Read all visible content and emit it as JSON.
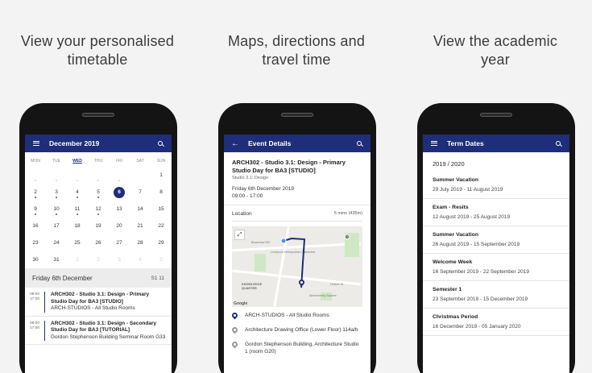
{
  "captions": [
    {
      "line1": "View your personalised",
      "line2": "timetable"
    },
    {
      "line1": "Maps, directions and",
      "line2": "travel time"
    },
    {
      "line1": "View the academic",
      "line2": "year"
    }
  ],
  "timetable": {
    "month_title": "December 2019",
    "weekdays": [
      "MON",
      "TUE",
      "WED",
      "THU",
      "FRI",
      "SAT",
      "SUN"
    ],
    "active_weekday": "WED",
    "rows": [
      [
        "",
        "",
        "",
        "",
        "",
        "",
        "1"
      ],
      [
        "2",
        "3",
        "4",
        "5",
        "6",
        "7",
        "8"
      ],
      [
        "9",
        "10",
        "11",
        "12",
        "13",
        "14",
        "15"
      ],
      [
        "16",
        "17",
        "18",
        "19",
        "20",
        "21",
        "22"
      ],
      [
        "23",
        "24",
        "25",
        "26",
        "27",
        "28",
        "29"
      ],
      [
        "30",
        "31",
        "1",
        "2",
        "3",
        "4",
        "5"
      ]
    ],
    "selected_day": "6",
    "day_header": "Friday 6th December",
    "week_label": "S1 11",
    "events": [
      {
        "start": "09:00",
        "end": "17:00",
        "title": "ARCH302 - Studio 3.1: Design - Primary Studio Day for BA3 [STUDIO]",
        "location": "ARCH-STUDIOS - All Studio Rooms"
      },
      {
        "start": "09:00",
        "end": "17:00",
        "title": "ARCH302 - Studio 3.1: Design - Secondary Studio Day for BA3 [TUTORIAL]",
        "location": "Gordon Stephenson Building Seminar Room G33"
      }
    ]
  },
  "event_details": {
    "title": "Event Details",
    "event_title": "ARCH302 - Studio 3.1: Design - Primary Studio Day for BA3 [STUDIO]",
    "event_subtitle": "Studio 3.1: Design",
    "date": "Friday 6th December 2019",
    "time": "09:00 - 17:00",
    "location_label": "Location",
    "travel_time": "5 mins (435m)",
    "map_labels": {
      "street": "Brownlow Hill",
      "cathedral": "Liverpool Metropolitan Cathedral",
      "quarter": "KNOWLEDGE QUARTER",
      "square": "Abercromby Square",
      "road": "Oxford St",
      "logo": "Google"
    },
    "locations": [
      "ARCH-STUDIOS - All Studio Rooms",
      "Architecture Drawing Office (Lower Floor) 114a/b",
      "Gordon Stephenson Building, Architecture Studio 1 (room G20)"
    ]
  },
  "term_dates": {
    "title": "Term Dates",
    "year": "2019 / 2020",
    "items": [
      {
        "name": "Summer Vacation",
        "range": "29 July 2019 - 11 August 2019"
      },
      {
        "name": "Exam - Resits",
        "range": "12 August 2019 - 25 August 2019"
      },
      {
        "name": "Summer Vacation",
        "range": "26 August 2019 - 15 September 2019"
      },
      {
        "name": "Welcome Week",
        "range": "16 September 2019 - 22 September 2019"
      },
      {
        "name": "Semester 1",
        "range": "23 September 2019 - 15 December 2019"
      },
      {
        "name": "Christmas Period",
        "range": "16 December 2019 - 05 January 2020"
      }
    ]
  },
  "colors": {
    "app_bar": "#1f2e7a",
    "background": "#f2f3f2"
  }
}
